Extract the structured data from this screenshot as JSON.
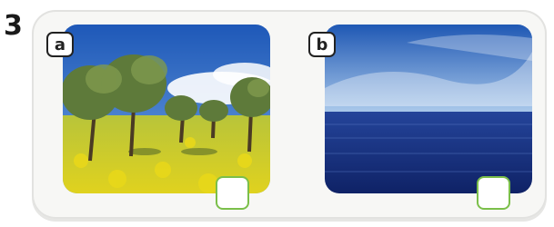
{
  "exercise": {
    "number": "3",
    "options": [
      {
        "letter": "a",
        "image": "olive-grove-yellow-flowers"
      },
      {
        "letter": "b",
        "image": "calm-sea-horizon"
      }
    ]
  },
  "colors": {
    "checkbox_border": "#7bbf4a",
    "panel_background": "#f7f7f5",
    "tag_border": "#222222"
  }
}
